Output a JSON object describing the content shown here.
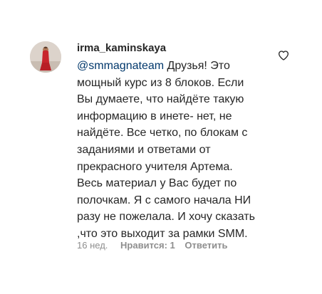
{
  "comment": {
    "username": "irma_kaminskaya",
    "mention": "@smmagnateam",
    "text": " Друзья! Это\nмощный курс из 8 блоков. Если\nВы думаете, что найдёте такую\nинформацию в инете- нет, не\nнайдёте. Все четко, по блокам с\nзаданиями и ответами от\nпрекрасного учителя Артема.\nВесь материал у Вас будет по\nполочкам. Я с самого начала НИ\nразу не пожелала. И хочу сказать\n,что это выходит за рамки SMM.",
    "time": "16 нед.",
    "likes_label": "Нравится: 1",
    "reply_label": "Ответить",
    "like_icon": "heart-outline-icon"
  },
  "colors": {
    "text": "#262626",
    "mention": "#00376b",
    "meta": "#8e8e8e"
  }
}
